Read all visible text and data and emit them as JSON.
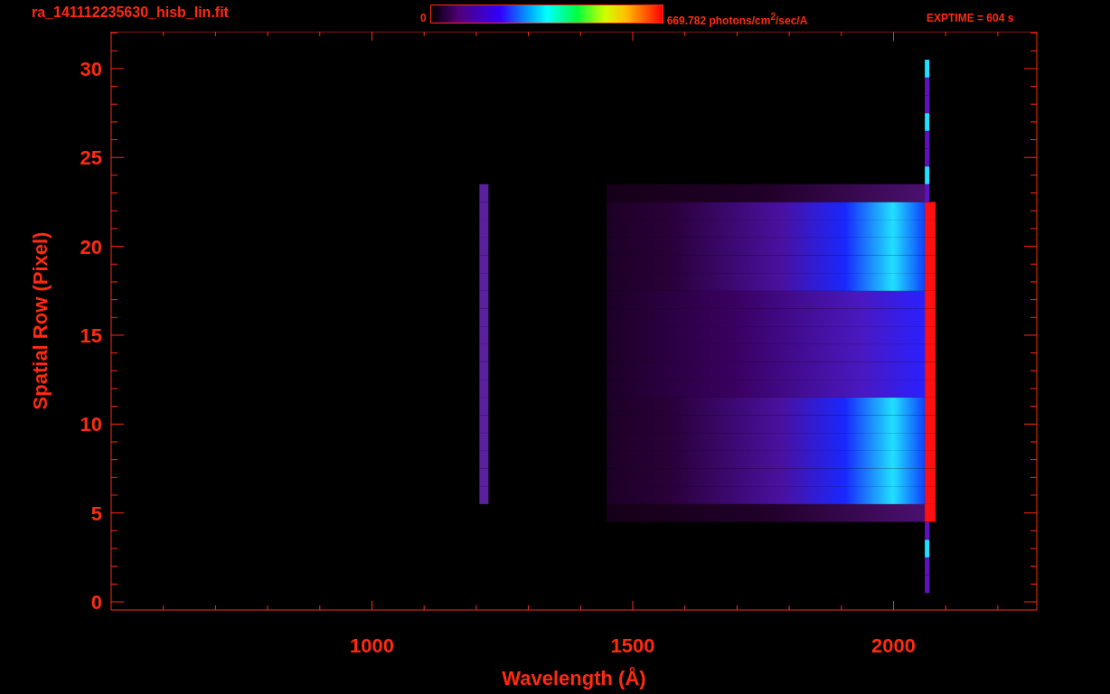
{
  "title": "ra_141112235630_hisb_lin.fit",
  "colorbar": {
    "min_label": "0",
    "max_label": "669.782 photons/cm$^{2}$/sec/A"
  },
  "exposure": "EXPTIME = 604 s",
  "plot": {
    "xlabel": "Wavelength (Å)",
    "ylabel": "Spatial Row (Pixel)",
    "xticks": [
      "1000",
      "1500",
      "2000"
    ],
    "yticks": [
      "30",
      "25",
      "20",
      "15",
      "10",
      "5",
      "0"
    ]
  }
}
